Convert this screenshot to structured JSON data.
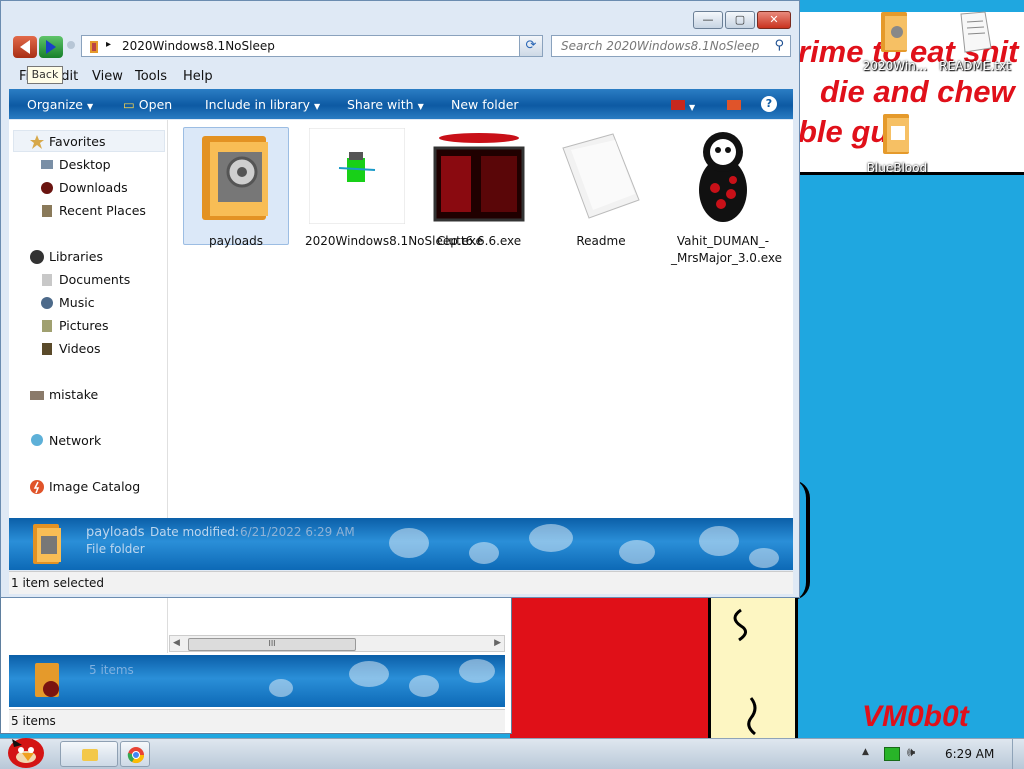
{
  "desktop": {
    "wallpaper_lines": [
      "rime to eat shit",
      "die and chew",
      "ble gun"
    ],
    "signature": "VM0b0t",
    "icons": [
      {
        "label": "2020Win...",
        "icon": "folder-icon"
      },
      {
        "label": "README.txt",
        "icon": "text-file-icon"
      },
      {
        "label": "BlueBlood",
        "icon": "folder-icon"
      }
    ]
  },
  "explorer": {
    "address_path": "2020Windows8.1NoSleep",
    "search_placeholder": "Search 2020Windows8.1NoSleep",
    "tooltip": "Back",
    "menu": [
      "File",
      "Edit",
      "View",
      "Tools",
      "Help"
    ],
    "commands": {
      "organize": "Organize",
      "open": "Open",
      "include_in_library": "Include in library",
      "share_with": "Share with",
      "new_folder": "New folder"
    },
    "nav": {
      "favorites": "Favorites",
      "desktop": "Desktop",
      "downloads": "Downloads",
      "recent_places": "Recent Places",
      "libraries": "Libraries",
      "documents": "Documents",
      "music": "Music",
      "pictures": "Pictures",
      "videos": "Videos",
      "mistake": "mistake",
      "network": "Network",
      "image_catalog": "Image Catalog"
    },
    "files": [
      {
        "name": "payloads",
        "type": "folder",
        "selected": true
      },
      {
        "name": "2020Windows8.1NoSleep.exe",
        "type": "exe"
      },
      {
        "name": "Clutt6.6.6.exe",
        "type": "exe"
      },
      {
        "name": "Readme",
        "type": "document"
      },
      {
        "name": "Vahit_DUMAN_-_MrsMajor_3.0.exe",
        "type": "exe"
      }
    ],
    "details": {
      "name": "payloads",
      "date_label": "Date modified:",
      "date_value": "6/21/2022 6:29 AM",
      "kind": "File folder"
    },
    "status": "1 item selected"
  },
  "back_window": {
    "details_count": "5 items",
    "status": "5 items",
    "scroll_grip": "III"
  },
  "taskbar": {
    "time": "6:29 AM"
  },
  "colors": {
    "accent_blue": "#0d5aa3",
    "wallpaper_red": "#e0101a",
    "desktop_blue": "#1fa7e0"
  }
}
